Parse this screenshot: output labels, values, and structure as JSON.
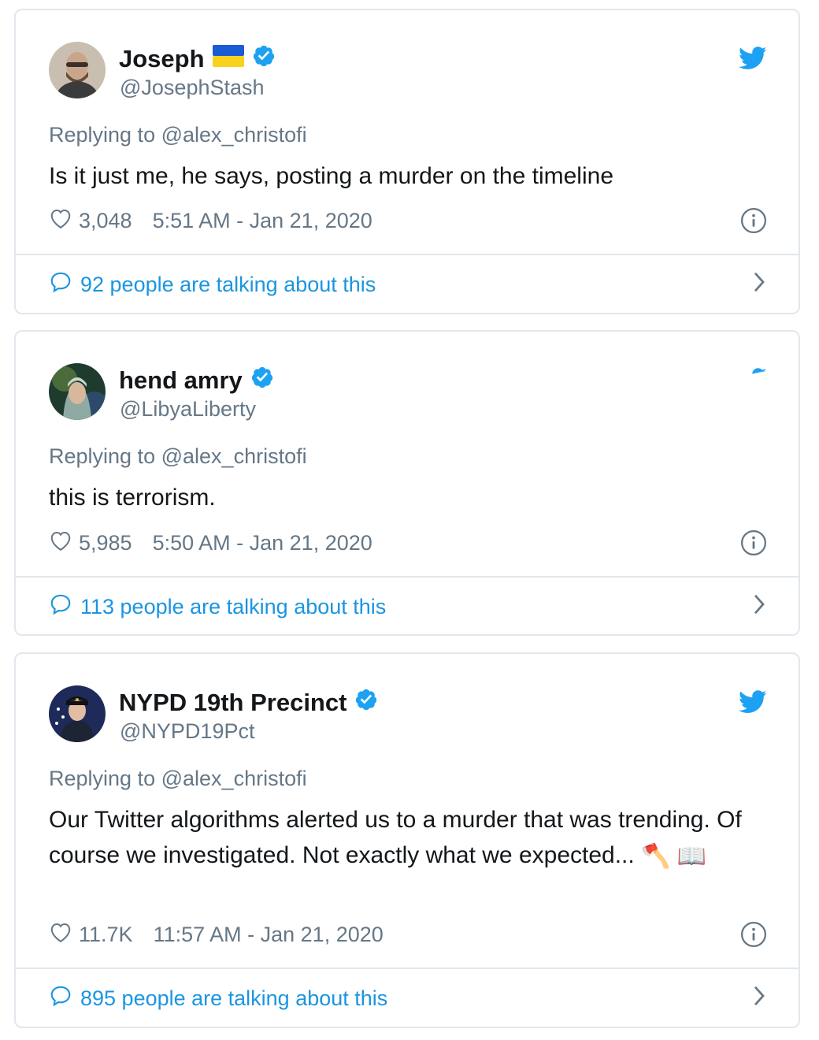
{
  "tweets": [
    {
      "display_name": "Joseph",
      "has_flag": true,
      "verified": true,
      "handle": "@JosephStash",
      "replying_label": "Replying to",
      "replying_to": "@alex_christofi",
      "text": "Is it just me, he says, posting a murder on the timeline",
      "emoji": "",
      "likes": "3,048",
      "timestamp": "5:51 AM - Jan 21, 2020",
      "talking": "92 people are talking about this"
    },
    {
      "display_name": "hend amry",
      "has_flag": false,
      "verified": true,
      "handle": "@LibyaLiberty",
      "replying_label": "Replying to",
      "replying_to": "@alex_christofi",
      "text": "this is terrorism.",
      "emoji": "",
      "likes": "5,985",
      "timestamp": "5:50 AM - Jan 21, 2020",
      "talking": "113 people are talking about this"
    },
    {
      "display_name": "NYPD 19th Precinct",
      "has_flag": false,
      "verified": true,
      "handle": "@NYPD19Pct",
      "replying_label": "Replying to",
      "replying_to": "@alex_christofi",
      "text": "Our Twitter algorithms alerted us to a murder that was trending. Of course we investigated. Not exactly what we expected...",
      "emoji": "🪓 📖",
      "likes": "11.7K",
      "timestamp": "11:57 AM - Jan 21, 2020",
      "talking": "895 people are talking about this"
    }
  ],
  "colors": {
    "link_blue": "#1b95e0",
    "twitter_blue": "#1da1f2",
    "muted": "#657786",
    "border": "#e1e8ed"
  },
  "icons": [
    "twitter-bird-icon",
    "verified-badge-icon",
    "heart-icon",
    "info-icon",
    "speech-bubble-icon",
    "chevron-right-icon",
    "ukraine-flag-icon"
  ]
}
